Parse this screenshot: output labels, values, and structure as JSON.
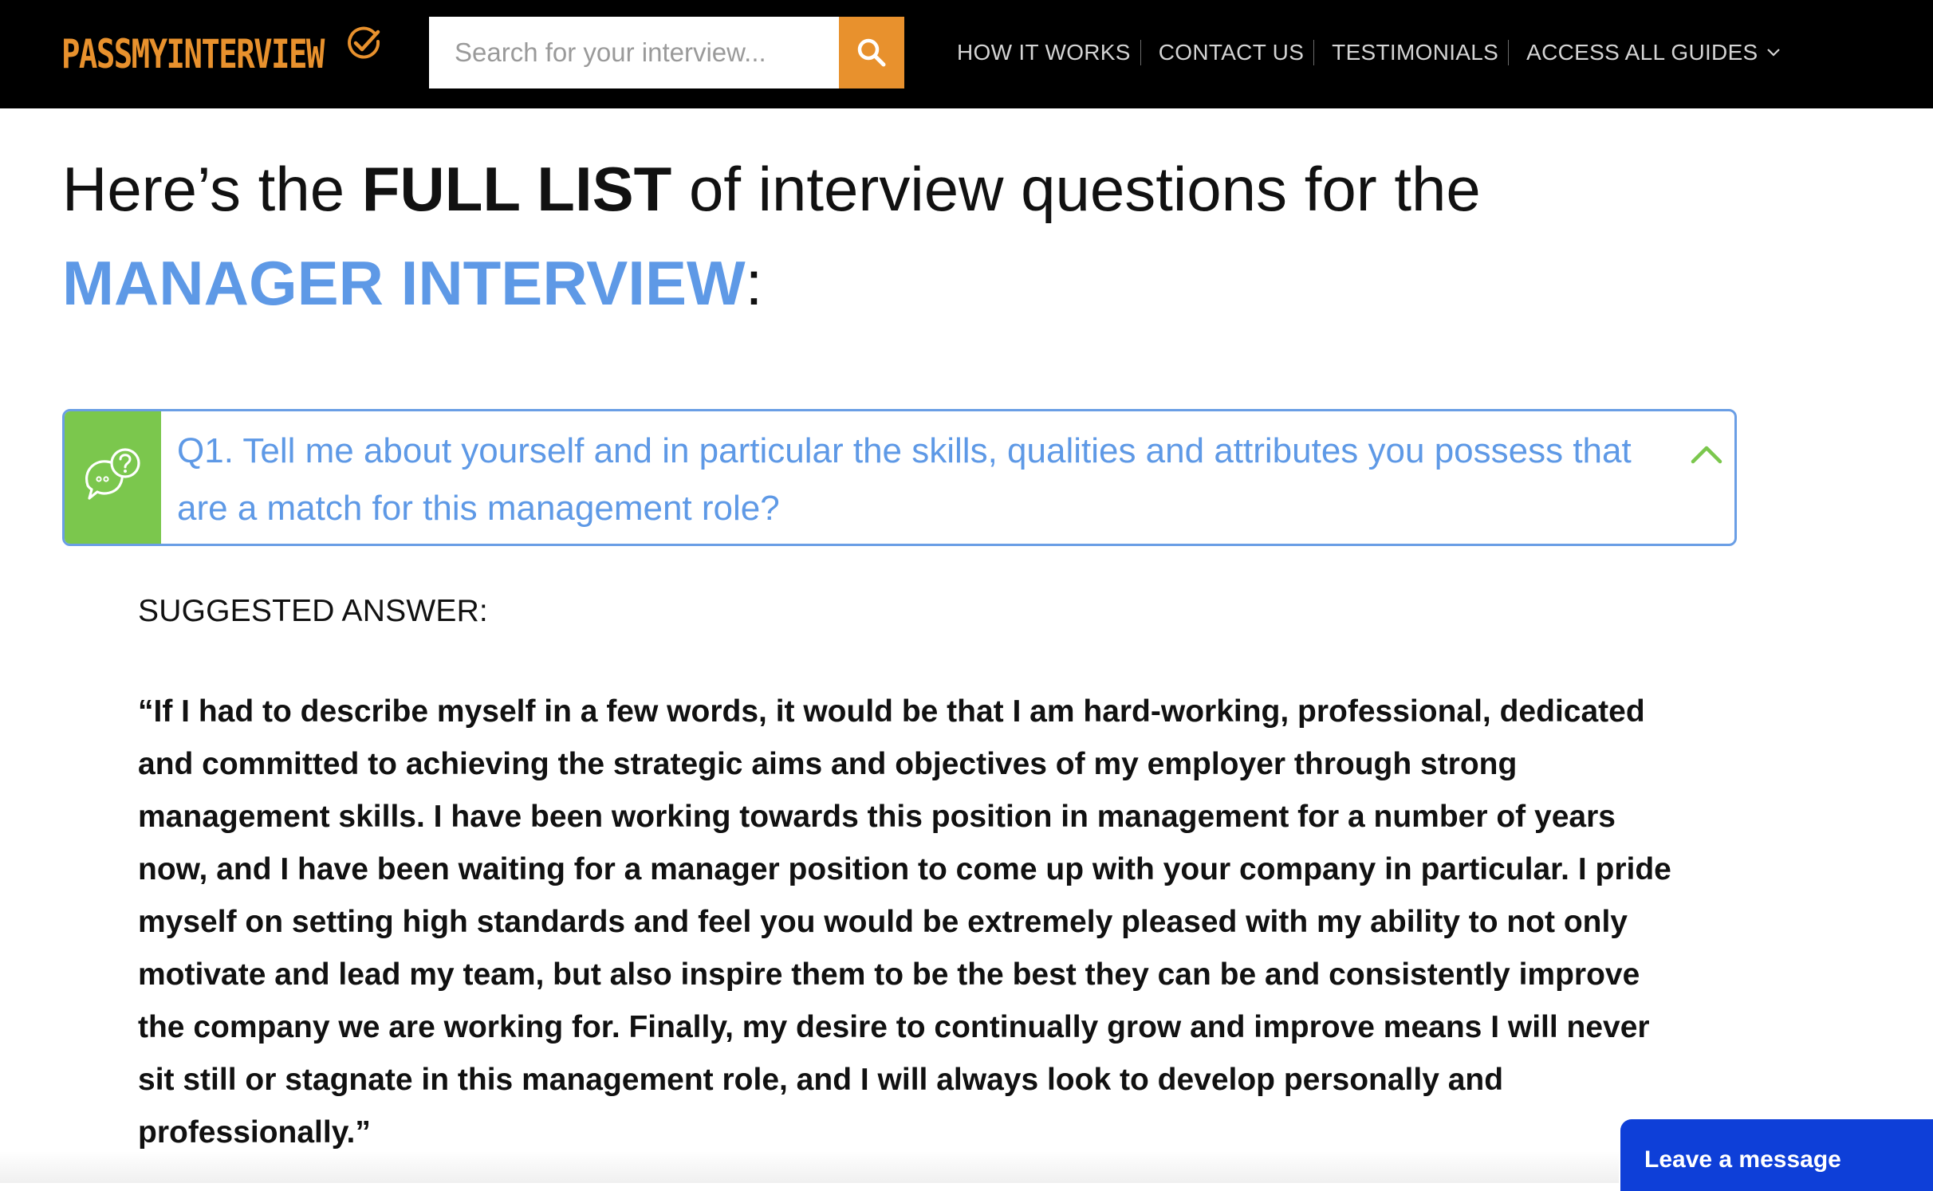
{
  "header": {
    "logo_text": "PASSMYINTERVIEW",
    "logo_icon": "check-circle-icon",
    "search": {
      "placeholder": "Search for your interview...",
      "value": "",
      "button_icon": "search-icon"
    },
    "nav": [
      {
        "label": "HOW IT WORKS"
      },
      {
        "label": "CONTACT US"
      },
      {
        "label": "TESTIMONIALS"
      },
      {
        "label": "ACCESS ALL GUIDES",
        "icon": "chevron-down-icon"
      }
    ]
  },
  "headline": {
    "part1": "Here’s the ",
    "part2": "FULL LIST",
    "part3": " of interview questions for the ",
    "part4": "MANAGER INTERVIEW",
    "part5": ":"
  },
  "question": {
    "icon": "speech-bubble-question-icon",
    "text": "Q1. Tell me about yourself and in particular the skills, qualities and attributes you possess that are a match for this management role?",
    "toggle_icon": "chevron-up-icon"
  },
  "answer": {
    "label": "SUGGESTED ANSWER:",
    "body": "“If I had to describe myself in a few words, it would be that I am hard-working, professional, dedicated and committed to achieving the strategic aims and objectives of my employer through strong management skills. I have been working towards this position in management for a number of years now, and I have been waiting for a manager position to come up with your company in particular. I pride myself on setting high standards and feel you would be extremely pleased with my ability to not only motivate and lead my team, but also inspire them to be the best they can be and consistently improve the company we are working for. Finally, my desire to continually grow and improve means I will never sit still or stagnate in this management role, and I will always look to develop personally and professionally.”"
  },
  "chat": {
    "label": "Leave a message"
  },
  "colors": {
    "brand_orange": "#e8912d",
    "accent_blue": "#5e99e6",
    "icon_green": "#7bc74d",
    "chat_blue": "#0e3fd8",
    "header_bg": "#000000"
  }
}
